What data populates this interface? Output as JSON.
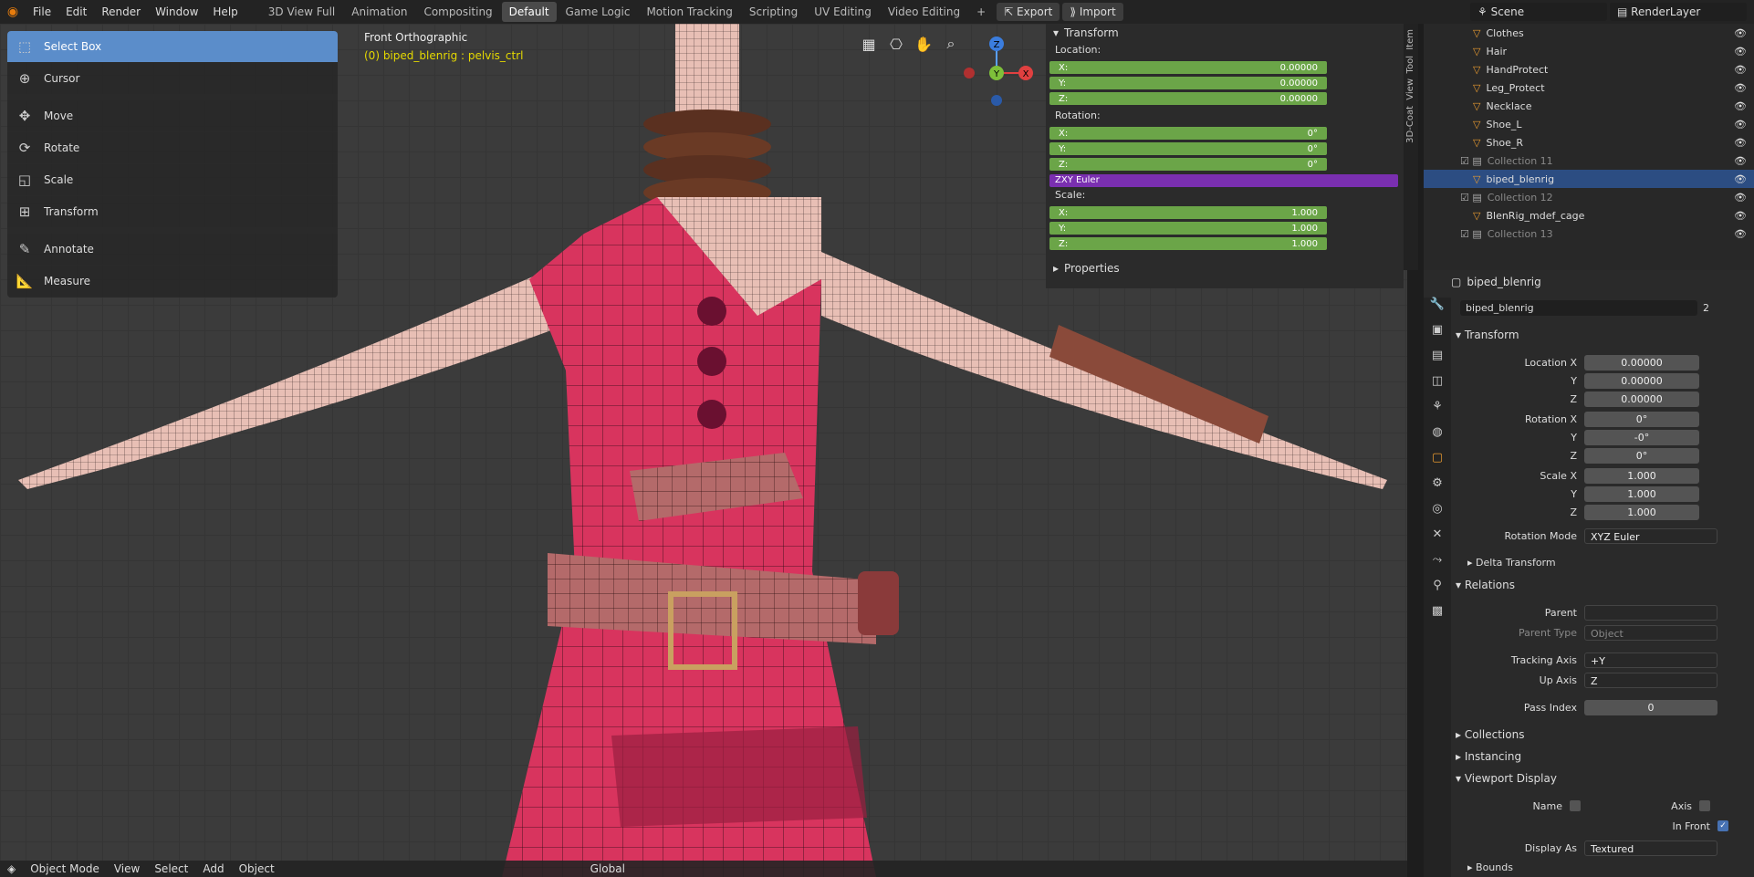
{
  "menu": {
    "items": [
      "File",
      "Edit",
      "Render",
      "Window",
      "Help"
    ]
  },
  "workspaces": {
    "tabs": [
      "3D View Full",
      "Animation",
      "Compositing",
      "Default",
      "Game Logic",
      "Motion Tracking",
      "Scripting",
      "UV Editing",
      "Video Editing"
    ],
    "active": "Default",
    "plus": "+"
  },
  "actions": {
    "export": "Export",
    "import": "Import"
  },
  "scene": {
    "label": "Scene",
    "layer": "RenderLayer"
  },
  "tools": [
    "Select Box",
    "Cursor",
    "Move",
    "Rotate",
    "Scale",
    "Transform",
    "Annotate",
    "Measure"
  ],
  "viewport": {
    "view": "Front Orthographic",
    "active": "(0) biped_blenrig : pelvis_ctrl"
  },
  "npanel": {
    "title": "Transform",
    "location_label": "Location:",
    "loc": {
      "x": "0.00000",
      "y": "0.00000",
      "z": "0.00000"
    },
    "rotation_label": "Rotation:",
    "rot": {
      "x": "0°",
      "y": "0°",
      "z": "0°"
    },
    "mode": "ZXY Euler",
    "scale_label": "Scale:",
    "scale": {
      "x": "1.000",
      "y": "1.000",
      "z": "1.000"
    },
    "properties": "Properties",
    "x": "X:",
    "y": "Y:",
    "z": "Z:",
    "vtabs": [
      "Item",
      "Tool",
      "View",
      "3D-Coat"
    ]
  },
  "vp_bottom": {
    "mode": "Object Mode",
    "menus": [
      "View",
      "Select",
      "Add",
      "Object"
    ],
    "orientation": "Global"
  },
  "outliner": {
    "rows": [
      {
        "name": "Clothes",
        "type": "obj"
      },
      {
        "name": "Hair",
        "type": "obj"
      },
      {
        "name": "HandProtect",
        "type": "obj"
      },
      {
        "name": "Leg_Protect",
        "type": "obj"
      },
      {
        "name": "Necklace",
        "type": "obj"
      },
      {
        "name": "Shoe_L",
        "type": "obj"
      },
      {
        "name": "Shoe_R",
        "type": "obj"
      },
      {
        "name": "Collection 11",
        "type": "col"
      },
      {
        "name": "biped_blenrig",
        "type": "sel"
      },
      {
        "name": "Collection 12",
        "type": "col"
      },
      {
        "name": "BlenRig_mdef_cage",
        "type": "obj"
      },
      {
        "name": "Collection 13",
        "type": "col"
      }
    ]
  },
  "props": {
    "object": "biped_blenrig",
    "datablock": "biped_blenrig",
    "users": "2",
    "transform": "Transform",
    "loc_x_label": "Location X",
    "loc_y_label": "Y",
    "loc_z_label": "Z",
    "loc": {
      "x": "0.00000",
      "y": "0.00000",
      "z": "0.00000"
    },
    "rot_x_label": "Rotation X",
    "rot_y_label": "Y",
    "rot_z_label": "Z",
    "rot": {
      "x": "0°",
      "y": "-0°",
      "z": "0°"
    },
    "scale_x_label": "Scale X",
    "scale_y_label": "Y",
    "scale_z_label": "Z",
    "scale": {
      "x": "1.000",
      "y": "1.000",
      "z": "1.000"
    },
    "rotation_mode_label": "Rotation Mode",
    "rotation_mode": "XYZ Euler",
    "delta": "Delta Transform",
    "relations": "Relations",
    "parent_label": "Parent",
    "parent_type_label": "Parent Type",
    "parent_type": "Object",
    "tracking_label": "Tracking Axis",
    "tracking": "+Y",
    "up_label": "Up Axis",
    "up": "Z",
    "pass_label": "Pass Index",
    "pass": "0",
    "collections": "Collections",
    "instancing": "Instancing",
    "viewport_display": "Viewport Display",
    "name_label": "Name",
    "axis_label": "Axis",
    "infront_label": "In Front",
    "display_as_label": "Display As",
    "display_as": "Textured",
    "bounds": "Bounds"
  }
}
